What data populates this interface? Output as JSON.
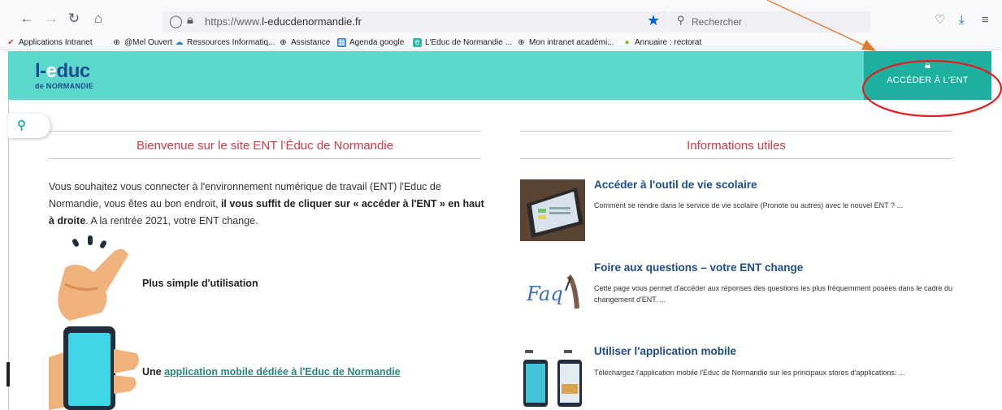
{
  "browser": {
    "url_prefix": "https://www.",
    "url_domain": "l-educdenormandie.fr",
    "search_placeholder": "Rechercher",
    "bookmarks": [
      {
        "label": "Applications Intranet",
        "color": "#d33d52"
      },
      {
        "label": "@Mel Ouvert",
        "color": "#555555"
      },
      {
        "label": "Ressources Informatiq...",
        "color": "#2d7fd0"
      },
      {
        "label": "Assistance",
        "color": "#555555"
      },
      {
        "label": "Agenda google",
        "color": "#2d7fd0"
      },
      {
        "label": "L'Educ de Normandie ...",
        "color": "#33b8a8"
      },
      {
        "label": "Mon intranet académi...",
        "color": "#555555"
      },
      {
        "label": "Annuaire : rectorat",
        "color": "#8ab832"
      }
    ]
  },
  "site": {
    "logo_line1_a": "l-",
    "logo_line1_b": "e",
    "logo_line1_c": "duc",
    "logo_line2": "de NORMANDIE",
    "ent_button": "ACCÉDER À L'ENT",
    "accent": "#5cd8cc",
    "accent_dark": "#1db09f"
  },
  "left": {
    "title": "Bienvenue sur le site ENT l'Éduc de Normandie",
    "intro_a": "Vous souhaitez vous connecter à l'environnement numérique de travail (ENT) l'Educ de Normandie, vous êtes au bon endroit, ",
    "intro_b": "il vous suffit de cliquer sur « accéder à l'ENT » en haut à droite",
    "intro_c": ". A la rentrée 2021, votre ENT change.",
    "feature1": "Plus simple d'utilisation",
    "feature2_a": "Une ",
    "feature2_link": "application mobile dédiée à l'Educ de Normandie"
  },
  "right": {
    "title": "Informations utiles",
    "items": [
      {
        "title": "Accéder à l'outil de vie scolaire",
        "desc": "Comment se rendre dans le service de vie scolaire (Pronote ou autres) avec le nouvel ENT ? ..."
      },
      {
        "title": "Foire aux questions – votre ENT change",
        "desc": "Cette page vous permet d'accéder aux réponses des questions les plus fréquemment posées dans le cadre du changement d'ENT. ..."
      },
      {
        "title": "Utiliser l'application mobile",
        "desc": "Téléchargez l'application mobile l'Educ de Normandie sur les principaux stores d'applications. ..."
      }
    ]
  },
  "icons": [
    "back-icon",
    "forward-icon",
    "reload-icon",
    "home-icon",
    "shield-icon",
    "lock-icon",
    "bookmark-star-icon",
    "search-icon",
    "pocket-icon",
    "download-icon",
    "menu-icon"
  ]
}
